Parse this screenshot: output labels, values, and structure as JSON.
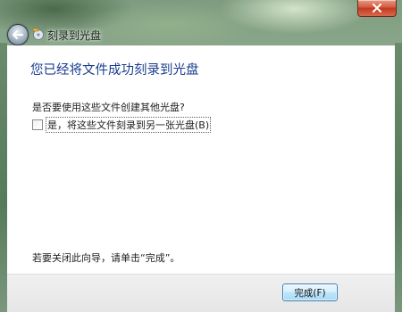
{
  "window": {
    "title": "刻录到光盘"
  },
  "page": {
    "heading": "您已经将文件成功刻录到光盘",
    "question": "是否要使用这些文件创建其他光盘?",
    "checkbox_label": "是，将这些文件刻录到另一张光盘(B)",
    "checkbox_checked": false,
    "close_hint": "若要关闭此向导，请单击“完成”。"
  },
  "footer": {
    "finish_label": "完成(F)"
  },
  "icons": {
    "back": "back-arrow-icon",
    "burn": "disc-burn-icon",
    "close": "close-icon"
  },
  "colors": {
    "heading": "#1a3d8f",
    "close_button": "#c9452a"
  }
}
